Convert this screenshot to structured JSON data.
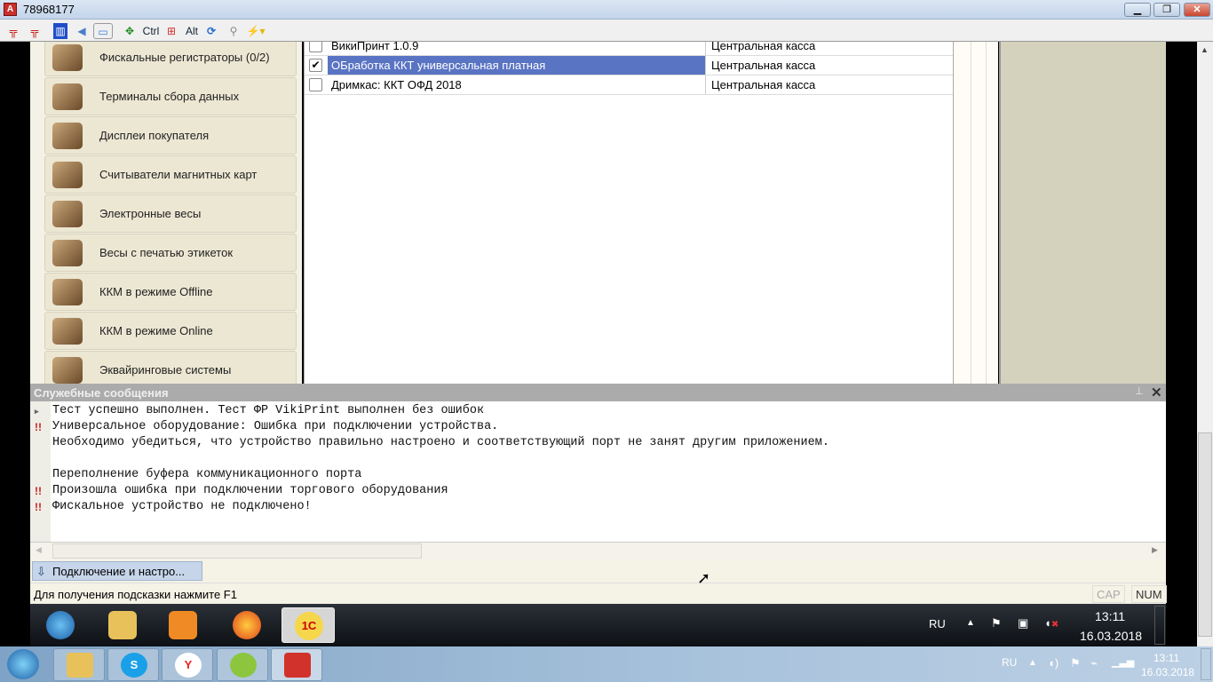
{
  "window": {
    "title": "78968177",
    "app_icon": "anydesk-icon"
  },
  "toolbar": {
    "items": [
      "ctrl-alt-del-icon",
      "ctrl-alt-del-2-icon",
      "split-icon",
      "sound-icon",
      "display-icon",
      "fullscreen-icon",
      "Ctrl",
      "windows-key-icon",
      "Alt",
      "refresh-icon",
      "plug-icon",
      "lightning-icon"
    ],
    "ctrl": "Ctrl",
    "alt": "Alt"
  },
  "devices": [
    {
      "label": "Фискальные регистраторы (0/2)",
      "icon": "fiscal-registrar-icon"
    },
    {
      "label": "Терминалы сбора данных",
      "icon": "data-terminal-icon"
    },
    {
      "label": "Дисплеи покупателя",
      "icon": "customer-display-icon"
    },
    {
      "label": "Считыватели магнитных карт",
      "icon": "card-reader-icon"
    },
    {
      "label": "Электронные весы",
      "icon": "scales-icon"
    },
    {
      "label": "Весы с печатью этикеток",
      "icon": "label-scales-icon"
    },
    {
      "label": "ККМ в режиме Offline",
      "icon": "kkm-offline-icon"
    },
    {
      "label": "ККМ в режиме Online",
      "icon": "kkm-online-icon"
    },
    {
      "label": "Эквайринговые системы",
      "icon": "acquiring-icon"
    }
  ],
  "grid": {
    "rows": [
      {
        "checked": false,
        "name": "ВикиПринт 1.0.9",
        "location": "Центральная касса"
      },
      {
        "checked": true,
        "name": "ОБработка ККТ универсальная платная",
        "location": "Центральная касса",
        "selected": true
      },
      {
        "checked": false,
        "name": "Дримкас: ККТ ОФД 2018",
        "location": "Центральная касса"
      }
    ]
  },
  "messages": {
    "title": "Служебные сообщения",
    "lines": [
      {
        "mark": "▸",
        "text": "Тест успешно выполнен. Тест ФР VikiPrint выполнен без ошибок"
      },
      {
        "mark": "!!",
        "text": "Универсальное оборудование: Ошибка при подключении устройства."
      },
      {
        "mark": "",
        "text": "Необходимо убедиться, что устройство правильно настроено и соответствующий порт не занят другим приложением."
      },
      {
        "mark": "",
        "text": ""
      },
      {
        "mark": "",
        "text": "Переполнение буфера коммуникационного порта"
      },
      {
        "mark": "!!",
        "text": "Произошла ошибка при подключении торгового оборудования"
      },
      {
        "mark": "!!",
        "text": "Фискальное устройство не подключено!"
      }
    ]
  },
  "window_tab": "Подключение и настро...",
  "status": {
    "hint": "Для получения подсказки нажмите F1",
    "cap": "CAP",
    "num": "NUM"
  },
  "remote_taskbar": {
    "lang": "RU",
    "time": "13:11",
    "date": "16.03.2018",
    "apps": [
      "start-icon",
      "explorer-icon",
      "media-player-icon",
      "firefox-icon",
      "1c-icon"
    ]
  },
  "local_taskbar": {
    "lang": "RU",
    "time": "13:11",
    "date": "16.03.2018",
    "apps": [
      "start-icon",
      "explorer-icon",
      "skype-icon",
      "yandex-icon",
      "android-icon",
      "anydesk-icon"
    ]
  }
}
